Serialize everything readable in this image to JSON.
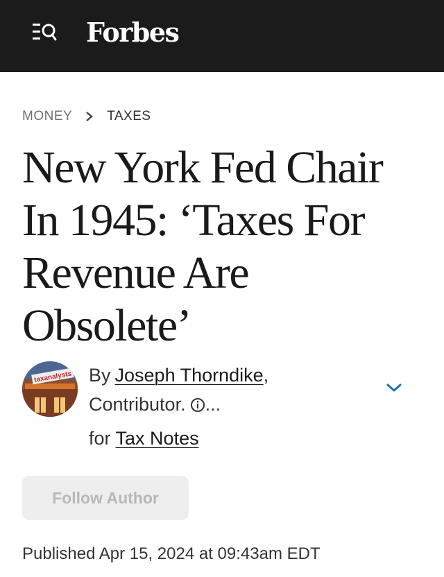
{
  "header": {
    "logo": "Forbes",
    "menu_icon": "menu-search-icon",
    "background_color": "#1b1b1b"
  },
  "breadcrumb": {
    "section": "MONEY",
    "separator_icon": "chevron-right-icon",
    "subsection": "TAXES"
  },
  "article": {
    "headline": "New York Fed Chair In 1945: ‘Taxes For Revenue Are Obsolete’",
    "byline": {
      "by": "By",
      "author": "Joseph Thorndike",
      "comma": ",",
      "role": "Contributor.",
      "info_icon": "info-icon",
      "ellipsis": "...",
      "for_word": "for",
      "publisher": "Tax Notes",
      "avatar_text": "taxanalysts",
      "expand_icon": "chevron-down-icon",
      "accent_color": "#1f6fb2"
    },
    "follow_button_label": "Follow Author",
    "published": "Published Apr 15, 2024 at 09:43am EDT"
  }
}
